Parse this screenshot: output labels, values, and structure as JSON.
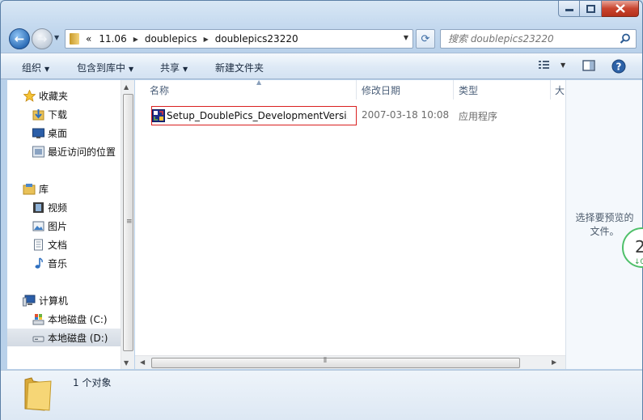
{
  "address": {
    "crumbs_prefix": "«",
    "crumbs": [
      "11.06",
      "doublepics",
      "doublepics23220"
    ]
  },
  "search": {
    "placeholder": "搜索 doublepics23220"
  },
  "toolbar": {
    "organize": "组织",
    "include_in_library": "包含到库中",
    "share": "共享",
    "new_folder": "新建文件夹"
  },
  "sidebar": {
    "favorites": "收藏夹",
    "downloads": "下载",
    "desktop": "桌面",
    "recent": "最近访问的位置",
    "libraries": "库",
    "videos": "视频",
    "pictures": "图片",
    "documents": "文档",
    "music": "音乐",
    "computer": "计算机",
    "drive_c": "本地磁盘 (C:)",
    "drive_d": "本地磁盘 (D:)"
  },
  "columns": {
    "name": "名称",
    "modified": "修改日期",
    "type": "类型",
    "size": "大"
  },
  "files": [
    {
      "name": "Setup_DoublePics_DevelopmentVersi...",
      "modified": "2007-03-18 10:08",
      "type": "应用程序"
    }
  ],
  "preview": {
    "line1": "选择要预览的",
    "line2": "文件。"
  },
  "badge": {
    "number": "2",
    "sub": "↓0."
  },
  "status": {
    "count": "1 个对象"
  },
  "colors": {
    "accent": "#3a6aa3",
    "selection_border": "#d92020",
    "badge": "#4fc06a"
  }
}
